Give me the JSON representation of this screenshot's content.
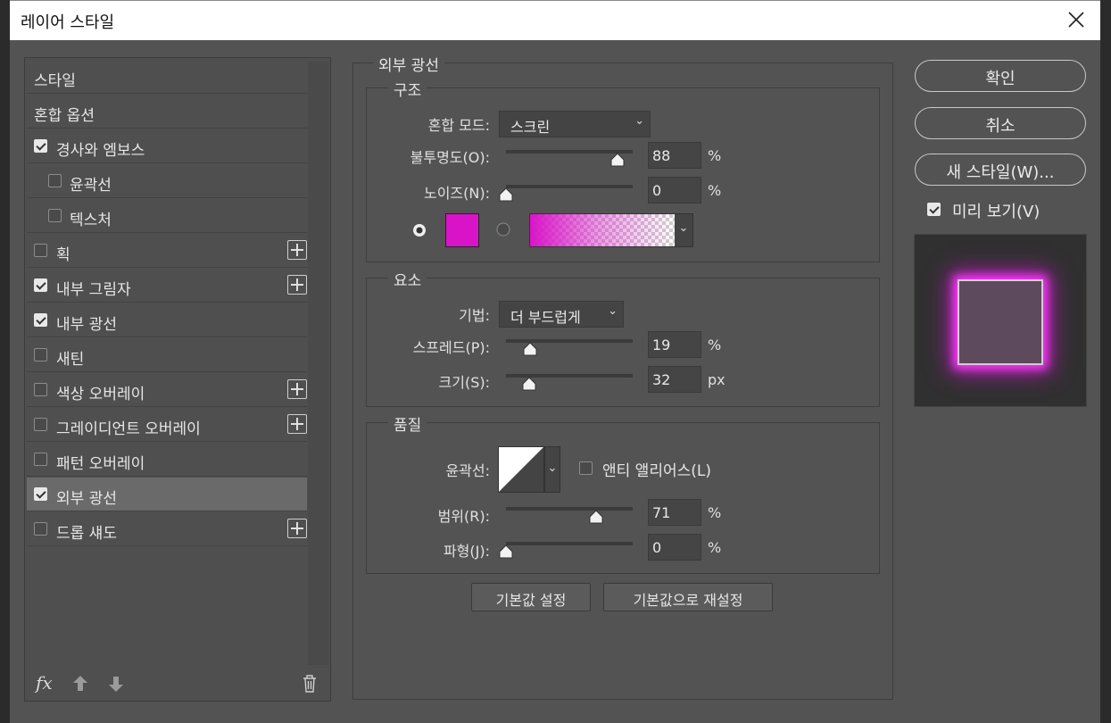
{
  "dialog": {
    "title": "레이어 스타일"
  },
  "styles": [
    {
      "label": "스타일",
      "checkbox": null,
      "indent": false,
      "plus": false,
      "selected": false
    },
    {
      "label": "혼합 옵션",
      "checkbox": null,
      "indent": false,
      "plus": false,
      "selected": false
    },
    {
      "label": "경사와 엠보스",
      "checkbox": true,
      "indent": false,
      "plus": false,
      "selected": false
    },
    {
      "label": "윤곽선",
      "checkbox": false,
      "indent": true,
      "plus": false,
      "selected": false
    },
    {
      "label": "텍스처",
      "checkbox": false,
      "indent": true,
      "plus": false,
      "selected": false
    },
    {
      "label": "획",
      "checkbox": false,
      "indent": false,
      "plus": true,
      "selected": false
    },
    {
      "label": "내부 그림자",
      "checkbox": true,
      "indent": false,
      "plus": true,
      "selected": false
    },
    {
      "label": "내부 광선",
      "checkbox": true,
      "indent": false,
      "plus": false,
      "selected": false
    },
    {
      "label": "새틴",
      "checkbox": false,
      "indent": false,
      "plus": false,
      "selected": false
    },
    {
      "label": "색상 오버레이",
      "checkbox": false,
      "indent": false,
      "plus": true,
      "selected": false
    },
    {
      "label": "그레이디언트 오버레이",
      "checkbox": false,
      "indent": false,
      "plus": true,
      "selected": false
    },
    {
      "label": "패턴 오버레이",
      "checkbox": false,
      "indent": false,
      "plus": false,
      "selected": false
    },
    {
      "label": "외부 광선",
      "checkbox": true,
      "indent": false,
      "plus": false,
      "selected": true
    },
    {
      "label": "드롭 섀도",
      "checkbox": false,
      "indent": false,
      "plus": true,
      "selected": false
    }
  ],
  "footer": {
    "fx": "fx"
  },
  "panel": {
    "title": "외부 광선",
    "structure": {
      "legend": "구조",
      "blend_label": "혼합 모드:",
      "blend_value": "스크린",
      "opacity_label": "불투명도(O):",
      "opacity_value": "88",
      "opacity_unit": "%",
      "opacity_fraction": 0.88,
      "noise_label": "노이즈(N):",
      "noise_value": "0",
      "noise_unit": "%",
      "noise_fraction": 0.0,
      "color": "#d914c8"
    },
    "elements": {
      "legend": "요소",
      "technique_label": "기법:",
      "technique_value": "더 부드럽게",
      "spread_label": "스프레드(P):",
      "spread_value": "19",
      "spread_unit": "%",
      "spread_fraction": 0.19,
      "size_label": "크기(S):",
      "size_value": "32",
      "size_unit": "px",
      "size_fraction": 0.18
    },
    "quality": {
      "legend": "품질",
      "contour_label": "윤곽선:",
      "antialias_label": "앤티 앨리어스(L)",
      "range_label": "범위(R):",
      "range_value": "71",
      "range_unit": "%",
      "range_fraction": 0.71,
      "jitter_label": "파형(J):",
      "jitter_value": "0",
      "jitter_unit": "%",
      "jitter_fraction": 0.0
    },
    "buttons": {
      "make_default": "기본값 설정",
      "reset_default": "기본값으로 재설정"
    }
  },
  "right": {
    "ok": "확인",
    "cancel": "취소",
    "new_style": "새 스타일(W)...",
    "preview_label": "미리 보기(V)"
  }
}
